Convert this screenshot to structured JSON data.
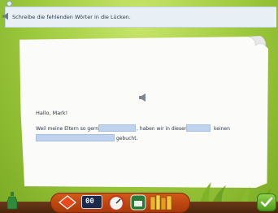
{
  "task": {
    "instruction": "Schreibe die fehlenden Wörter in die Lücken."
  },
  "letter": {
    "greeting": "Hallo, Mark!",
    "line1_part1": "Weil meine Eltern so gerne",
    "line1_part2": ", haben wir in diesem",
    "line1_part3": "keinen",
    "line2_part1": "gebucht."
  },
  "gaps": [
    {
      "value": ""
    },
    {
      "value": ""
    },
    {
      "value": ""
    }
  ],
  "toolbar": {
    "score_display": "00"
  },
  "colors": {
    "accent_green": "#9bc63a",
    "gap_fill": "#bfd3ef",
    "bar_orange": "#d25a1a"
  }
}
